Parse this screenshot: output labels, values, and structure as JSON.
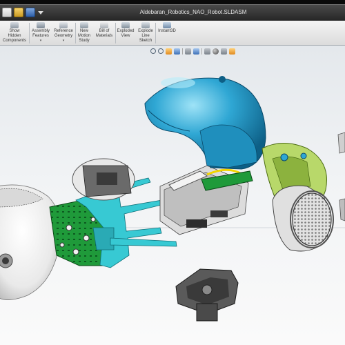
{
  "window": {
    "title": "Aldebaran_Robotics_NAO_Robot.SLDASM"
  },
  "quick_access": {
    "icons": [
      "new-document-icon",
      "open-folder-icon",
      "save-icon",
      "dropdown-arrow-icon"
    ]
  },
  "ribbon": {
    "buttons": [
      {
        "label": "Show\nHidden\nComponents",
        "icon": "show-hidden-icon",
        "caret": ""
      },
      {
        "label": "Assembly\nFeatures",
        "icon": "assembly-features-icon",
        "caret": "▾"
      },
      {
        "label": "Reference\nGeometry",
        "icon": "reference-geometry-icon",
        "caret": "▾"
      },
      {
        "label": "New\nMotion\nStudy",
        "icon": "motion-study-icon",
        "caret": ""
      },
      {
        "label": "Bill of\nMaterials",
        "icon": "bill-of-materials-icon",
        "caret": ""
      },
      {
        "label": "Exploded\nView",
        "icon": "exploded-view-icon",
        "caret": ""
      },
      {
        "label": "Explode\nLine\nSketch",
        "icon": "explode-line-sketch-icon",
        "caret": ""
      },
      {
        "label": "Instant3D",
        "icon": "instant3d-icon",
        "caret": ""
      }
    ]
  },
  "view_toolbar": {
    "icons": [
      "zoom-to-fit-icon",
      "zoom-area-icon",
      "previous-view-icon",
      "section-view-icon",
      "view-orientation-icon",
      "display-style-icon",
      "hide-show-icon",
      "edit-appearance-icon",
      "apply-scene-icon",
      "view-settings-icon"
    ]
  },
  "model": {
    "colors": {
      "head_shell": "#2fa7d4",
      "pcb_green": "#1f9a3a",
      "frame_cyan": "#37c9d3",
      "lime_frame": "#b8d86a",
      "white_parts": "#f3f3f3",
      "dark_parts": "#3a3a3a"
    }
  }
}
